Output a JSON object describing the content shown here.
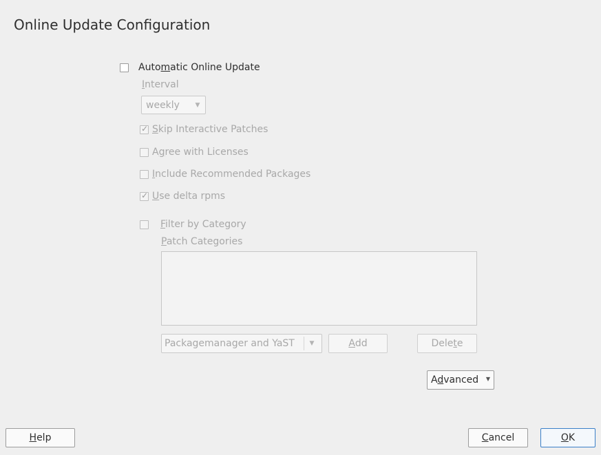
{
  "dialog": {
    "title": "Online Update Configuration"
  },
  "auto_update": {
    "label_pre": "Auto",
    "label_ul": "m",
    "label_post": "atic Online Update",
    "checked": false
  },
  "interval": {
    "label_ul": "I",
    "label_post": "nterval",
    "value": "weekly"
  },
  "options": [
    {
      "ul": "S",
      "rest": "kip Interactive Patches",
      "checked": true,
      "check_mark": "✓"
    },
    {
      "pre": "A",
      "ul": "g",
      "rest": "ree with Licenses",
      "checked": false
    },
    {
      "ul": "I",
      "rest": "nclude Recommended Packages",
      "checked": false
    },
    {
      "ul": "U",
      "rest": "se delta rpms",
      "checked": true,
      "check_mark": "✓"
    }
  ],
  "filter": {
    "ul": "F",
    "rest": "ilter by Category",
    "checked": false
  },
  "patch_categories": {
    "ul": "P",
    "rest": "atch Categories",
    "items": []
  },
  "category_combo": {
    "value": "Packagemanager and YaST"
  },
  "buttons": {
    "add": {
      "ul": "A",
      "rest": "dd"
    },
    "delete": {
      "pre": "Dele",
      "ul": "t",
      "rest": "e"
    },
    "advanced": {
      "pre": "A",
      "ul": "d",
      "rest": "vanced"
    },
    "help": {
      "ul": "H",
      "rest": "elp"
    },
    "cancel": {
      "ul": "C",
      "rest": "ancel"
    },
    "ok": {
      "ul": "O",
      "rest": "K"
    }
  },
  "icons": {
    "dropdown": "chevron-down-icon"
  },
  "colors": {
    "default_button_border": "#3a7fc8",
    "disabled_text": "#a8a8a8",
    "background": "#efefef"
  }
}
